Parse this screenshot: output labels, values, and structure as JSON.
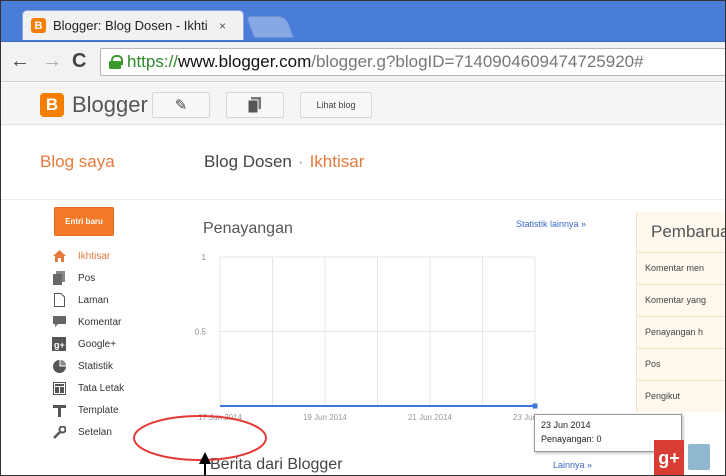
{
  "browser": {
    "tab_title": "Blogger: Blog Dosen - Ikhti",
    "tab_close": "×",
    "url_scheme": "https://",
    "url_host": "www.blogger.com",
    "url_path": "/blogger.g?blogID=7140904609474725920#"
  },
  "header": {
    "logo_letter": "B",
    "brand": "Blogger",
    "view_blog": "Lihat blog"
  },
  "titlebar": {
    "my_blogs": "Blog saya",
    "blog_name": "Blog Dosen",
    "separator": "·",
    "section": "Ikhtisar"
  },
  "sidebar": {
    "new_post": "Entri baru",
    "items": [
      {
        "label": "Ikhtisar",
        "icon": "home-icon"
      },
      {
        "label": "Pos",
        "icon": "posts-icon"
      },
      {
        "label": "Laman",
        "icon": "page-icon"
      },
      {
        "label": "Komentar",
        "icon": "comment-icon"
      },
      {
        "label": "Google+",
        "icon": "google-plus-icon"
      },
      {
        "label": "Statistik",
        "icon": "stats-icon"
      },
      {
        "label": "Tata Letak",
        "icon": "layout-icon"
      },
      {
        "label": "Template",
        "icon": "template-icon"
      },
      {
        "label": "Setelan",
        "icon": "wrench-icon"
      }
    ]
  },
  "stats": {
    "title": "Penayangan",
    "more_link": "Statistik lainnya »",
    "tooltip_date": "23 Jun 2014",
    "tooltip_value": "Penayangan: 0"
  },
  "chart_data": {
    "type": "line",
    "x": [
      "17 Jun 2014",
      "19 Jun 2014",
      "21 Jun 2014",
      "23 Jun 2014"
    ],
    "y_ticks": [
      "1",
      "0.5"
    ],
    "values": [
      0,
      0,
      0,
      0,
      0,
      0,
      0
    ],
    "ylim": [
      0,
      1
    ],
    "grid": true,
    "color": "#3c78d8"
  },
  "updates": {
    "title": "Pembarua",
    "rows": [
      "Komentar men",
      "Komentar yang",
      "Penayangan h",
      "Pos",
      "Pengikut"
    ]
  },
  "news": {
    "title": "Berita dari Blogger",
    "more_link": "Lainnya »"
  },
  "colors": {
    "accent": "#f37a28",
    "link": "#3a6ac4",
    "annotation": "#e53935"
  }
}
